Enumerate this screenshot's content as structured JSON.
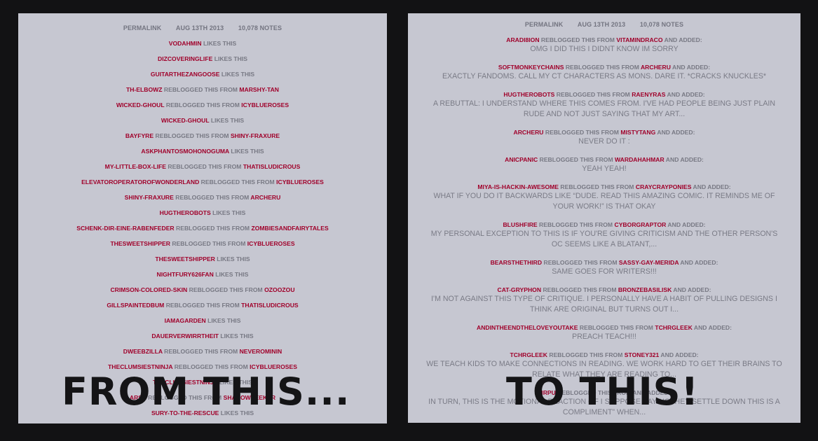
{
  "left": {
    "permalink": "PERMALINK",
    "date": "AUG 13TH 2013",
    "notes_count": "10,078 NOTES",
    "notes": [
      {
        "user": "VODAHMIN",
        "action": "LIKES THIS"
      },
      {
        "user": "DIZCOVERINGLIFE",
        "action": "LIKES THIS"
      },
      {
        "user": "GUITARTHEZANGOOSE",
        "action": "LIKES THIS"
      },
      {
        "user": "TH-ELBOWZ",
        "action": "REBLOGGED THIS FROM",
        "source": "MARSHY-TAN"
      },
      {
        "user": "WICKED-GHOUL",
        "action": "REBLOGGED THIS FROM",
        "source": "ICYBLUEROSES"
      },
      {
        "user": "WICKED-GHOUL",
        "action": "LIKES THIS"
      },
      {
        "user": "BAYFYRE",
        "action": "REBLOGGED THIS FROM",
        "source": "SHINY-FRAXURE"
      },
      {
        "user": "ASKPHANTOSMOHONOGUMA",
        "action": "LIKES THIS"
      },
      {
        "user": "MY-LITTLE-BOX-LIFE",
        "action": "REBLOGGED THIS FROM",
        "source": "THATISLUDICROUS"
      },
      {
        "user": "ELEVATOROPERATOROFWONDERLAND",
        "action": "REBLOGGED THIS FROM",
        "source": "ICYBLUEROSES"
      },
      {
        "user": "SHINY-FRAXURE",
        "action": "REBLOGGED THIS FROM",
        "source": "ARCHERU"
      },
      {
        "user": "HUGTHEROBOTS",
        "action": "LIKES THIS"
      },
      {
        "user": "SCHENK-DIR-EINE-RABENFEDER",
        "action": "REBLOGGED THIS FROM",
        "source": "ZOMBIESANDFAIRYTALES"
      },
      {
        "user": "THESWEETSHIPPER",
        "action": "REBLOGGED THIS FROM",
        "source": "ICYBLUEROSES"
      },
      {
        "user": "THESWEETSHIPPER",
        "action": "LIKES THIS"
      },
      {
        "user": "NIGHTFURY626FAN",
        "action": "LIKES THIS"
      },
      {
        "user": "CRIMSON-COLORED-SKIN",
        "action": "REBLOGGED THIS FROM",
        "source": "OZOOZOU"
      },
      {
        "user": "GILLSPAINTEDBUM",
        "action": "REBLOGGED THIS FROM",
        "source": "THATISLUDICROUS"
      },
      {
        "user": "IAMAGARDEN",
        "action": "LIKES THIS"
      },
      {
        "user": "DAUERVERWIRRTHEIT",
        "action": "LIKES THIS"
      },
      {
        "user": "DWEEBZILLA",
        "action": "REBLOGGED THIS FROM",
        "source": "NEVEROMININ"
      },
      {
        "user": "THECLUMSIESTNINJA",
        "action": "REBLOGGED THIS FROM",
        "source": "ICYBLUEROSES"
      },
      {
        "user": "THECLUMSIESTNINJA",
        "action": "LIKES THIS"
      },
      {
        "user": "ARSE",
        "action": "REBLOGGED THIS FROM",
        "source": "SHADOWSEEKER"
      },
      {
        "user": "SURY-TO-THE-RESCUE",
        "action": "LIKES THIS"
      }
    ]
  },
  "right": {
    "permalink": "PERMALINK",
    "date": "AUG 13TH 2013",
    "notes_count": "10,078 NOTES",
    "notes": [
      {
        "user": "ARADI8ION",
        "action": "REBLOGGED THIS FROM",
        "source": "VITAMINDRACO",
        "suffix": "AND ADDED:",
        "body": "OMG I DID THIS I DIDNT KNOW IM SORRY"
      },
      {
        "user": "SOFTMONKEYCHAINS",
        "action": "REBLOGGED THIS FROM",
        "source": "ARCHERU",
        "suffix": "AND ADDED:",
        "body": "EXACTLY FANDOMS. CALL MY CT CHARACTERS AS MONS. DARE IT. *CRACKS KNUCKLES*"
      },
      {
        "user": "HUGTHEROBOTS",
        "action": "REBLOGGED THIS FROM",
        "source": "RAENYRAS",
        "suffix": "AND ADDED:",
        "body": "A REBUTTAL: I UNDERSTAND WHERE THIS COMES FROM. I'VE HAD PEOPLE BEING JUST PLAIN RUDE AND NOT JUST SAYING THAT MY ART..."
      },
      {
        "user": "ARCHERU",
        "action": "REBLOGGED THIS FROM",
        "source": "MISTYTANG",
        "suffix": "AND ADDED:",
        "body": "NEVER DO IT :"
      },
      {
        "user": "ANICPANIC",
        "action": "REBLOGGED THIS FROM",
        "source": "WARDAHAHMAR",
        "suffix": "AND ADDED:",
        "body": "YEAH YEAH!"
      },
      {
        "user": "MIYA-IS-HACKIN-AWESOME",
        "action": "REBLOGGED THIS FROM",
        "source": "CRAYCRAYPONIES",
        "suffix": "AND ADDED:",
        "body": "WHAT IF YOU DO IT BACKWARDS LIKE “DUDE. READ THIS AMAZING COMIC. IT REMINDS ME OF YOUR WORK!” IS THAT OKAY"
      },
      {
        "user": "BLUSHFIRE",
        "action": "REBLOGGED THIS FROM",
        "source": "CYBORGRAPTOR",
        "suffix": "AND ADDED:",
        "body": "MY PERSONAL EXCEPTION TO THIS IS IF YOU'RE GIVING CRITICISM AND THE OTHER PERSON'S OC SEEMS LIKE A BLATANT,..."
      },
      {
        "user": "BEARSTHETHIRD",
        "action": "REBLOGGED THIS FROM",
        "source": "SASSY-GAY-MERIDA",
        "suffix": "AND ADDED:",
        "body": "SAME GOES FOR WRITERS!!!"
      },
      {
        "user": "CAT-GRYPHON",
        "action": "REBLOGGED THIS FROM",
        "source": "BRONZEBASILISK",
        "suffix": "AND ADDED:",
        "body": "I'M NOT AGAINST THIS TYPE OF CRITIQUE. I PERSONALLY HAVE A HABIT OF PULLING DESIGNS I THINK ARE ORIGINAL BUT TURNS OUT I..."
      },
      {
        "user": "ANDINTHEENDTHELOVEYOUTAKE",
        "action": "REBLOGGED THIS FROM",
        "source": "TCHRGLEEK",
        "suffix": "AND ADDED:",
        "body": "PREACH TEACH!!!"
      },
      {
        "user": "TCHRGLEEK",
        "action": "REBLOGGED THIS FROM",
        "source": "STONEY321",
        "suffix": "AND ADDED:",
        "body": "WE TEACH KIDS TO MAKE CONNECTIONS IN READING. WE WORK HARD TO GET THEIR BRAINS TO RELATE WHAT THEY ARE READING TO..."
      },
      {
        "user": "MRPU",
        "action": "REBLOGGED THIS FROM",
        "source": "",
        "suffix": "AND ADDED:",
        "body": "IN TURN, THIS IS THE MOTIONAL REACTION OF I SUPPOSE SAYING “HEY SETTLE DOWN THIS IS A COMPLIMENT” WHEN..."
      }
    ]
  },
  "banners": {
    "left": "FROM THIS...",
    "right": "TO THIS!"
  },
  "colors": {
    "username": "#a0002a",
    "panel": "#c6c7d1",
    "background": "#121214"
  }
}
